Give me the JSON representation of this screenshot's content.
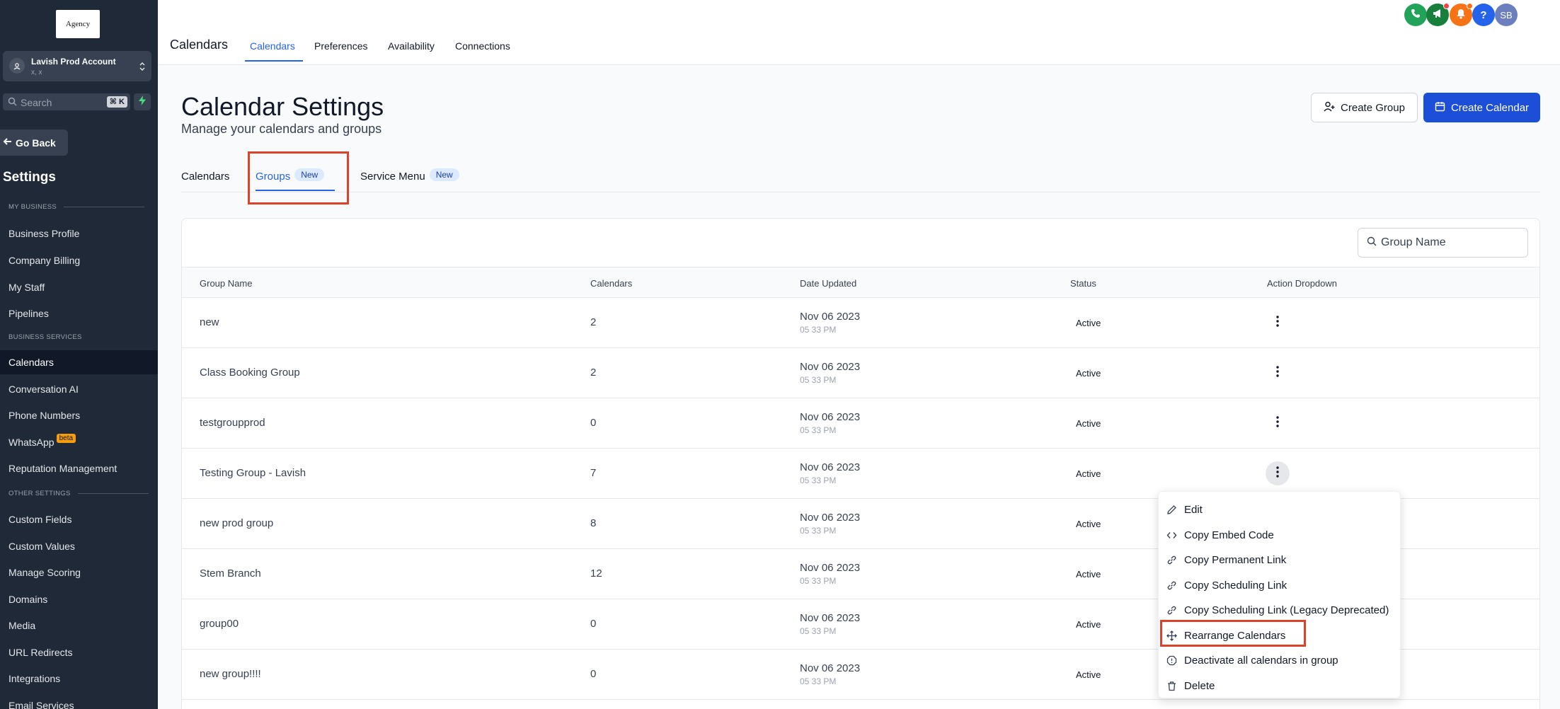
{
  "sidebar": {
    "logo_text": "Agency",
    "account": {
      "name": "Lavish Prod Account",
      "sub": "x, x"
    },
    "search": {
      "placeholder": "Search",
      "shortcut": "⌘ K"
    },
    "go_back": "Go Back",
    "title": "Settings",
    "sections": {
      "my_business": "MY BUSINESS",
      "business_services": "BUSINESS SERVICES",
      "other_settings": "OTHER SETTINGS"
    },
    "items": [
      "Business Profile",
      "Company Billing",
      "My Staff",
      "Pipelines",
      "Calendars",
      "Conversation AI",
      "Phone Numbers",
      "WhatsApp",
      "Reputation Management",
      "Custom Fields",
      "Custom Values",
      "Manage Scoring",
      "Domains",
      "Media",
      "URL Redirects",
      "Integrations",
      "Email Services"
    ],
    "beta_label": "beta"
  },
  "topbar": {
    "title": "Calendars",
    "tabs": [
      "Calendars",
      "Preferences",
      "Availability",
      "Connections"
    ],
    "avatar_initials": "SB",
    "help_glyph": "?"
  },
  "header": {
    "title": "Calendar Settings",
    "subtitle": "Manage your calendars and groups",
    "create_group": "Create Group",
    "create_calendar": "Create Calendar"
  },
  "subtabs": {
    "calendars": "Calendars",
    "groups": "Groups",
    "service_menu": "Service Menu",
    "new_badge": "New"
  },
  "table": {
    "search_placeholder": "Group Name",
    "columns": [
      "Group Name",
      "Calendars",
      "Date Updated",
      "Status",
      "Action Dropdown"
    ],
    "rows": [
      {
        "name": "new",
        "calendars": "2",
        "date": "Nov 06 2023",
        "time": "05 33 PM",
        "status": "Active"
      },
      {
        "name": "Class Booking Group",
        "calendars": "2",
        "date": "Nov 06 2023",
        "time": "05 33 PM",
        "status": "Active"
      },
      {
        "name": "testgroupprod",
        "calendars": "0",
        "date": "Nov 06 2023",
        "time": "05 33 PM",
        "status": "Active"
      },
      {
        "name": "Testing Group - Lavish",
        "calendars": "7",
        "date": "Nov 06 2023",
        "time": "05 33 PM",
        "status": "Active"
      },
      {
        "name": "new prod group",
        "calendars": "8",
        "date": "Nov 06 2023",
        "time": "05 33 PM",
        "status": "Active"
      },
      {
        "name": "Stem Branch",
        "calendars": "12",
        "date": "Nov 06 2023",
        "time": "05 33 PM",
        "status": "Active"
      },
      {
        "name": "group00",
        "calendars": "0",
        "date": "Nov 06 2023",
        "time": "05 33 PM",
        "status": "Active"
      },
      {
        "name": "new group!!!!",
        "calendars": "0",
        "date": "Nov 06 2023",
        "time": "05 33 PM",
        "status": "Active"
      }
    ]
  },
  "dropdown": {
    "items": [
      {
        "label": "Edit",
        "icon": "pencil-icon"
      },
      {
        "label": "Copy Embed Code",
        "icon": "code-icon"
      },
      {
        "label": "Copy Permanent Link",
        "icon": "link-icon"
      },
      {
        "label": "Copy Scheduling Link",
        "icon": "link-icon"
      },
      {
        "label": "Copy Scheduling Link (Legacy Deprecated)",
        "icon": "link-icon"
      },
      {
        "label": "Rearrange Calendars",
        "icon": "move-icon"
      },
      {
        "label": "Deactivate all calendars in group",
        "icon": "octagon-icon"
      },
      {
        "label": "Delete",
        "icon": "trash-icon"
      }
    ]
  },
  "colors": {
    "sidebar_bg": "#1f2937",
    "accent": "#2563eb",
    "primary_button": "#1d4ed8",
    "highlight": "#d9432b"
  }
}
